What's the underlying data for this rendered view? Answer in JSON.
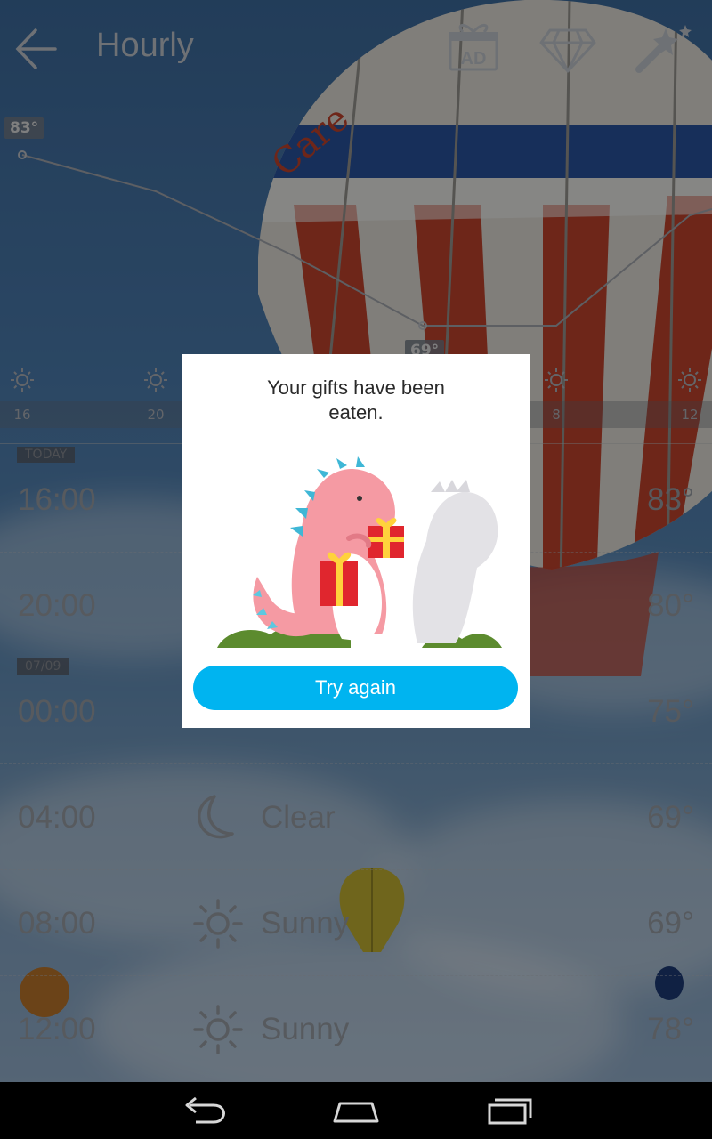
{
  "header": {
    "title": "Hourly",
    "icons": [
      "back-arrow-icon",
      "ad-gift-icon",
      "diamond-icon",
      "magic-wand-icon"
    ]
  },
  "chart": {
    "high_tag": "83°",
    "low_tag": "69°",
    "hour_labels": [
      "16",
      "20",
      "8",
      "12"
    ]
  },
  "rows": [
    {
      "badge": "TODAY",
      "time": "16:00",
      "condition": "",
      "temp": "83°",
      "icon": "sun-icon"
    },
    {
      "badge": "",
      "time": "20:00",
      "condition": "",
      "temp": "80°",
      "icon": ""
    },
    {
      "badge": "07/09",
      "time": "00:00",
      "condition": "",
      "temp": "75°",
      "icon": ""
    },
    {
      "badge": "",
      "time": "04:00",
      "condition": "Clear",
      "temp": "69°",
      "icon": "moon-icon"
    },
    {
      "badge": "",
      "time": "08:00",
      "condition": "Sunny",
      "temp": "69°",
      "icon": "sun-icon"
    },
    {
      "badge": "",
      "time": "12:00",
      "condition": "Sunny",
      "temp": "78°",
      "icon": "sun-icon"
    }
  ],
  "dialog": {
    "message": "Your gifts have been eaten.",
    "button_label": "Try again",
    "art": "dinosaur-eating-gifts-illustration"
  },
  "navbar": {
    "icons": [
      "nav-back-icon",
      "nav-home-icon",
      "nav-recents-icon"
    ]
  },
  "colors": {
    "accent": "#00b4f0",
    "dialog_bg": "#ffffff",
    "dim_text": "#9ea4ac"
  }
}
